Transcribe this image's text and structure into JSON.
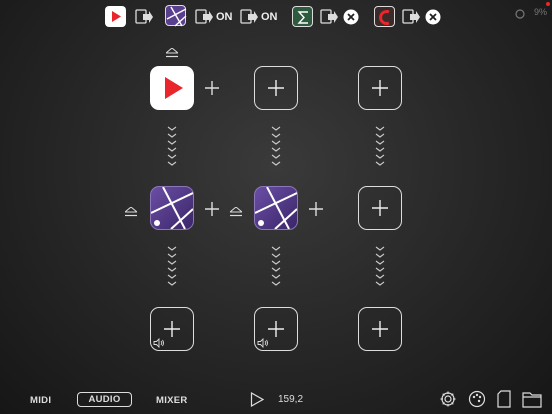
{
  "topbar": {
    "items": [
      {
        "type": "app",
        "name": "youtube"
      },
      {
        "type": "route-icon"
      },
      {
        "type": "app",
        "name": "purple-app"
      },
      {
        "type": "route-icon"
      },
      {
        "type": "toggle",
        "label": "ON"
      },
      {
        "type": "route-icon"
      },
      {
        "type": "toggle",
        "label": "ON"
      },
      {
        "type": "app",
        "name": "sum-app"
      },
      {
        "type": "route-icon"
      },
      {
        "type": "close"
      },
      {
        "type": "app",
        "name": "red-app"
      },
      {
        "type": "route-icon"
      },
      {
        "type": "close"
      }
    ],
    "on1": "ON",
    "on2": "ON",
    "battery": "9%"
  },
  "colors": {
    "accent_red": "#e8262c",
    "purple": "#5b3f8f",
    "border": "#dddddd",
    "bg": "#262626"
  },
  "grid": {
    "rows": [
      [
        "youtube-app",
        "empty",
        "empty"
      ],
      [
        "purple-app",
        "purple-app",
        "empty"
      ],
      [
        "empty-output",
        "empty-output",
        "empty"
      ]
    ],
    "purple_badge": "a"
  },
  "bottombar": {
    "midi": "MIDI",
    "audio": "AUDIO",
    "mixer": "MIXER",
    "tempo": "159,2",
    "icons": [
      "play-icon",
      "settings-gear-icon",
      "palette-icon",
      "document-icon",
      "folder-icon"
    ]
  }
}
